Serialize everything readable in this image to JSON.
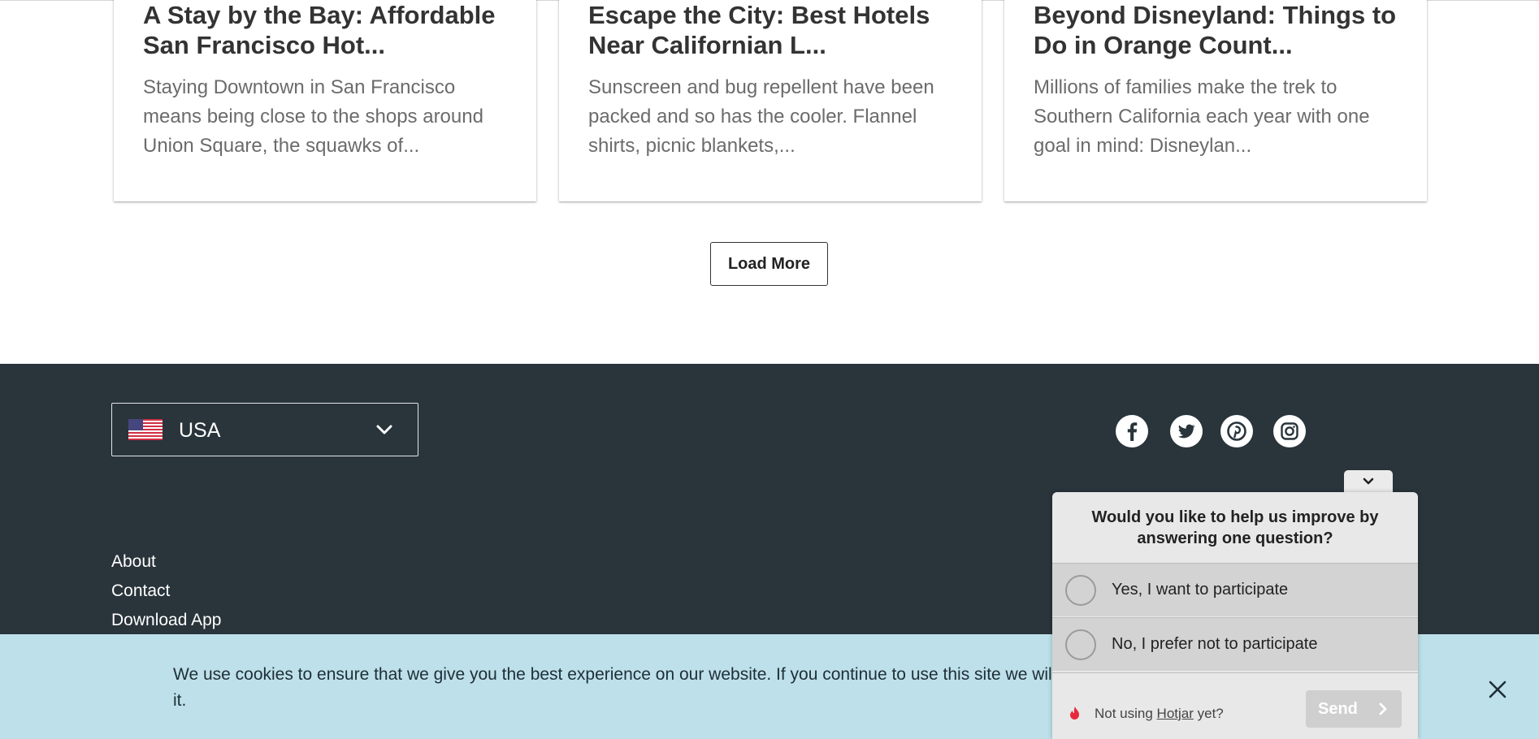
{
  "cards": [
    {
      "title": "A Stay by the Bay: Affordable San Francisco Hot...",
      "excerpt": "Staying Downtown in San Francisco means being close to the shops around Union Square, the squawks of..."
    },
    {
      "title": "Escape the City: Best Hotels Near Californian L...",
      "excerpt": "Sunscreen and bug repellent have been packed and so has the cooler. Flannel shirts, picnic blankets,..."
    },
    {
      "title": "Beyond Disneyland: Things to Do in Orange Count...",
      "excerpt": "Millions of families make the trek to Southern California each year with one goal in mind: Disneylan..."
    }
  ],
  "load_more_label": "Load More",
  "footer": {
    "country_selector": {
      "selected": "USA",
      "flag_icon": "us-flag-icon"
    },
    "social_icons": [
      "facebook-icon",
      "twitter-icon",
      "pinterest-icon",
      "instagram-icon"
    ],
    "links": [
      "About",
      "Contact",
      "Download App"
    ]
  },
  "cookie_banner": {
    "text_line1": "We use cookies to ensure that we give you the best experience on our website. If you continue to use this site we wil",
    "text_line2": "it."
  },
  "survey": {
    "question": "Would you like to help us improve by answering one question?",
    "options": [
      "Yes, I want to participate",
      "No, I prefer not to participate"
    ],
    "footer_note_prefix": "Not using ",
    "footer_note_link": "Hotjar",
    "footer_note_suffix": " yet?",
    "send_label": "Send"
  },
  "colors": {
    "footer_bg": "#29343b",
    "cookie_bg": "#bde0ea",
    "survey_bg": "#e8e8e8",
    "flame": "#e8293b"
  }
}
